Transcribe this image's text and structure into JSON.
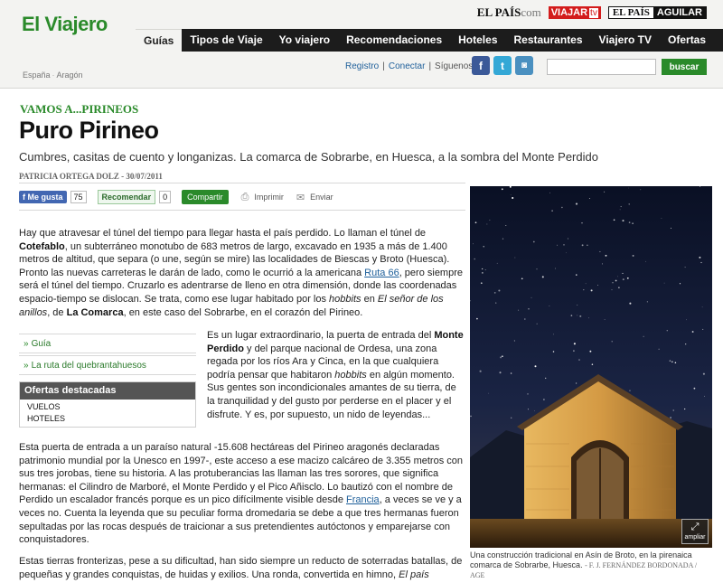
{
  "brand": {
    "logo": "El Viajero"
  },
  "partners": {
    "elpais": "EL PAÍS",
    "elpais_com": "com",
    "viajar": "VIAJAR",
    "viajar_tv": "tv",
    "aguilar_left": "EL PAÍS",
    "aguilar_right": "AGUILAR"
  },
  "nav": [
    "Guías",
    "Tipos de Viaje",
    "Yo viajero",
    "Recomendaciones",
    "Hoteles",
    "Restaurantes",
    "Viajero TV",
    "Ofertas"
  ],
  "breadcrumb": [
    "España",
    "Aragón"
  ],
  "toolbar": {
    "registro": "Registro",
    "conectar": "Conectar",
    "siguenos": "Síguenos:",
    "search_button": "buscar",
    "search_value": ""
  },
  "article": {
    "kicker": "VAMOS A...PIRINEOS",
    "title": "Puro Pirineo",
    "subtitle": "Cumbres, casitas de cuento y longanizas. La comarca de Sobrarbe, en Huesca, a la sombra del Monte Perdido",
    "byline": "PATRICIA ORTEGA DOLZ - 30/07/2011"
  },
  "share": {
    "like": "Me gusta",
    "like_count": "75",
    "recommend": "Recomendar",
    "recommend_count": "0",
    "share": "Compartir",
    "print": "Imprimir",
    "send": "Enviar"
  },
  "related": {
    "link1": "Guía",
    "link2": "La ruta del quebrantahuesos"
  },
  "offers": {
    "title": "Ofertas destacadas",
    "items": [
      "VUELOS",
      "HOTELES"
    ]
  },
  "body": {
    "p1": [
      "Hay que atravesar el túnel del tiempo para llegar hasta el país perdido. Lo llaman el túnel de ",
      "Cotefablo",
      ", un subterráneo monotubo de 683 metros de largo, excavado en 1935 a más de 1.400 metros de altitud, que separa (o une, según se mire) las localidades de Biescas y Broto (Huesca). Pronto las nuevas carreteras le darán de lado, como le ocurrió a la americana ",
      "Ruta 66",
      ", pero siempre será el túnel del tiempo. Cruzarlo es adentrarse de lleno en otra dimensión, donde las coordenadas espacio-tiempo se dislocan. Se trata, como ese lugar habitado por los ",
      "hobbits",
      " en ",
      "El señor de los anillos",
      ", de ",
      "La Comarca",
      ", en este caso del Sobrarbe, en el corazón del Pirineo."
    ],
    "p2": [
      "Es un lugar extraordinario, la puerta de entrada del ",
      "Monte Perdido",
      " y del parque nacional de Ordesa, una zona regada por los ríos Ara y Cinca, en la que cualquiera podría pensar que habitaron ",
      "hobbits",
      " en algún momento. Sus gentes son incondicionales amantes de su tierra, de la tranquilidad y del gusto por perderse en el placer y el disfrute. Y es, por supuesto, un nido de leyendas..."
    ],
    "p3": [
      "Esta puerta de entrada a un paraíso natural -15.608 hectáreas del Pirineo aragonés declaradas patrimonio mundial por la Unesco en 1997-, este acceso a ese macizo calcáreo de 3.355 metros con sus tres jorobas, tiene su historia. A las protuberancias las llaman las tres sorores, que significa hermanas: el Cilindro de Marboré, el Monte Perdido y el Pico Añisclo. Lo bautizó con el nombre de Perdido un escalador francés porque es un pico difícilmente visible desde ",
      "Francia",
      ", a veces se ve y a veces no. Cuenta la leyenda que su peculiar forma dromedaria se debe a que tres hermanas fueron sepultadas por las rocas después de traicionar a sus pretendientes autóctonos y emparejarse con conquistadores."
    ],
    "p4": [
      "Estas tierras fronterizas, pese a su dificultad, han sido siempre un reducto de soterradas batallas, de pequeñas y grandes conquistas, de huidas y exilios. Una ronda, convertida en himno, ",
      "El país"
    ]
  },
  "photo": {
    "ampliar": "ampliar",
    "caption": "Una construcción tradicional en Asín de Broto, en la pirenaica comarca de Sobrarbe, Huesca.",
    "credit": "- F. J. FERNÁNDEZ BORDONADA / AGE"
  }
}
